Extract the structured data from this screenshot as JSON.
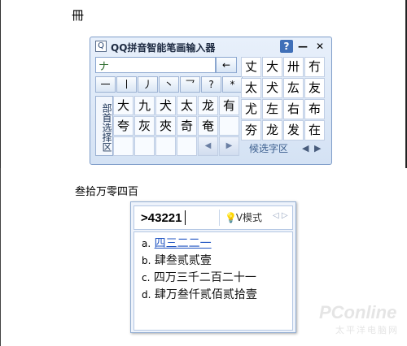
{
  "top_text": "冊",
  "ime": {
    "title": "QQ拼音智能笔画输入器",
    "logo": "Q",
    "help_label": "?",
    "minimize_label": "—",
    "close_label": "✕",
    "stroke_input_value": "ナ",
    "backspace_label": "←",
    "stroke_keys": [
      "一",
      "丨",
      "丿",
      "丶",
      "乛",
      "?",
      "*"
    ],
    "radical_label": "部首选择区",
    "radicals": [
      "大",
      "九",
      "犬",
      "太",
      "龙",
      "有",
      "夸",
      "灰",
      "夾",
      "奇",
      "奄",
      ""
    ],
    "radical_nav": [
      "◀",
      "▶"
    ],
    "candidates": [
      "丈",
      "大",
      "卅",
      "冇",
      "太",
      "犬",
      "厷",
      "友",
      "尤",
      "左",
      "右",
      "布",
      "夯",
      "龙",
      "发",
      "在"
    ],
    "candidate_footer": "候选字区",
    "cand_prev": "◀",
    "cand_next": "▶"
  },
  "mid_text": "叁拾万零四百",
  "vmode": {
    "input": ">43221",
    "badge": "V模式",
    "bulb_icon": "lightbulb-icon",
    "arrows": "◁ ▷",
    "items": [
      {
        "key": "a.",
        "text": "四三二二一"
      },
      {
        "key": "b.",
        "text": "肆叁贰贰壹"
      },
      {
        "key": "c.",
        "text": "四万三千二百二十一"
      },
      {
        "key": "d.",
        "text": "肆万叁仟贰佰贰拾壹"
      }
    ]
  },
  "watermark": {
    "main": "PConline",
    "sub": "太平洋电脑网"
  }
}
